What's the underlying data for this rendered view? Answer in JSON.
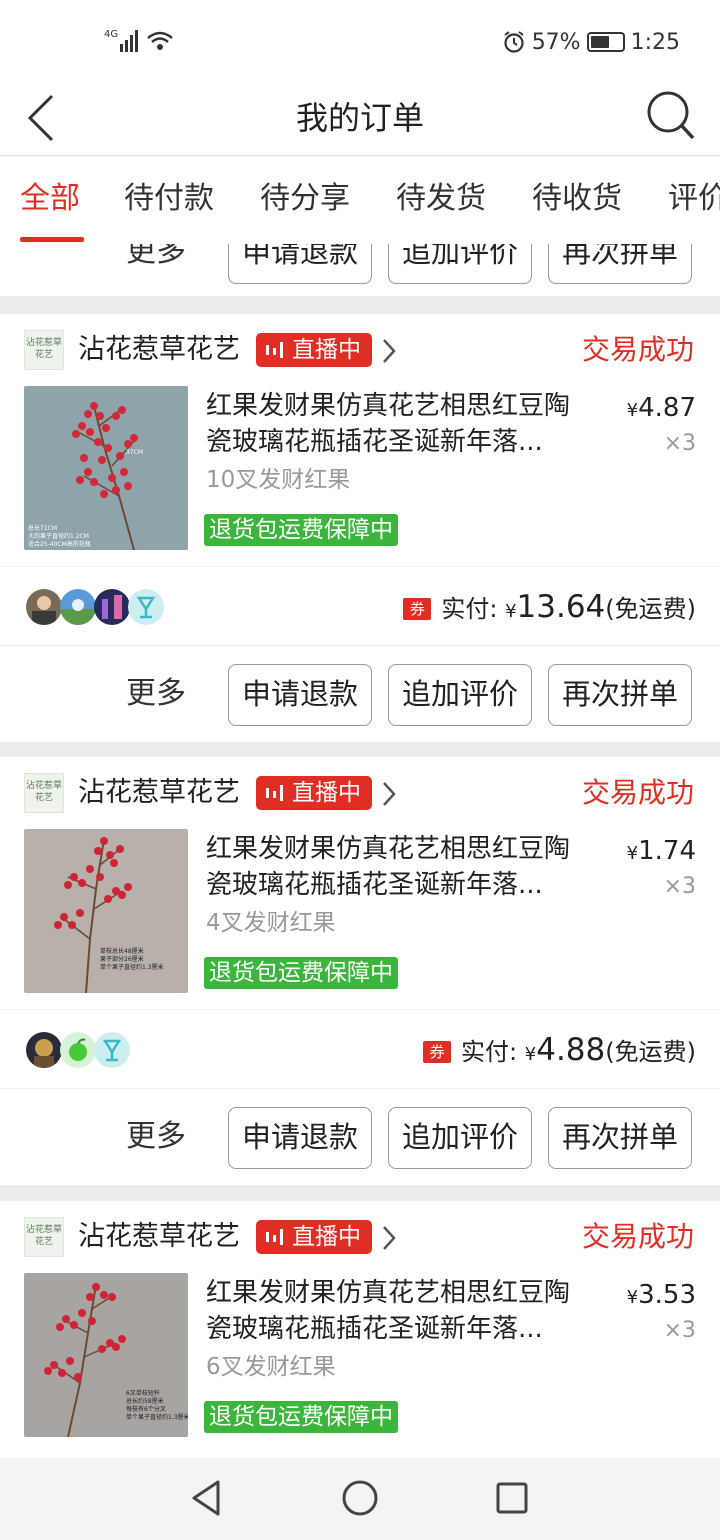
{
  "status_bar": {
    "network": "4G",
    "battery": "57%",
    "time": "1:25"
  },
  "nav": {
    "title": "我的订单"
  },
  "tabs": [
    "全部",
    "待付款",
    "待分享",
    "待发货",
    "待收货",
    "评价"
  ],
  "actions": {
    "more": "更多",
    "refund": "申请退款",
    "add_review": "追加评价",
    "reorder": "再次拼单"
  },
  "shop": {
    "name": "沾花惹草花艺",
    "logo_text": "沾花惹草花艺",
    "live": "直播中",
    "status": "交易成功"
  },
  "guarantee": "退货包运费保障中",
  "pay_labels": {
    "coupon": "券",
    "paid": "实付:",
    "currency": "¥",
    "free_shipping": "(免运费)"
  },
  "orders": [
    {
      "title_line1": "红果发财果仿真花艺相思红豆陶",
      "title_line2": "瓷玻璃花瓶插花圣诞新年落...",
      "price": "4.87",
      "qty": "×3",
      "spec": "10叉发财红果",
      "paid": "13.64"
    },
    {
      "title_line1": "红果发财果仿真花艺相思红豆陶",
      "title_line2": "瓷玻璃花瓶插花圣诞新年落...",
      "price": "1.74",
      "qty": "×3",
      "spec": "4叉发财红果",
      "paid": "4.88"
    },
    {
      "title_line1": "红果发财果仿真花艺相思红豆陶",
      "title_line2": "瓷玻璃花瓶插花圣诞新年落...",
      "price": "3.53",
      "qty": "×3",
      "spec": "6叉发财红果"
    }
  ],
  "colors": {
    "accent": "#e02e24",
    "guarantee_green": "#3cb53c"
  }
}
